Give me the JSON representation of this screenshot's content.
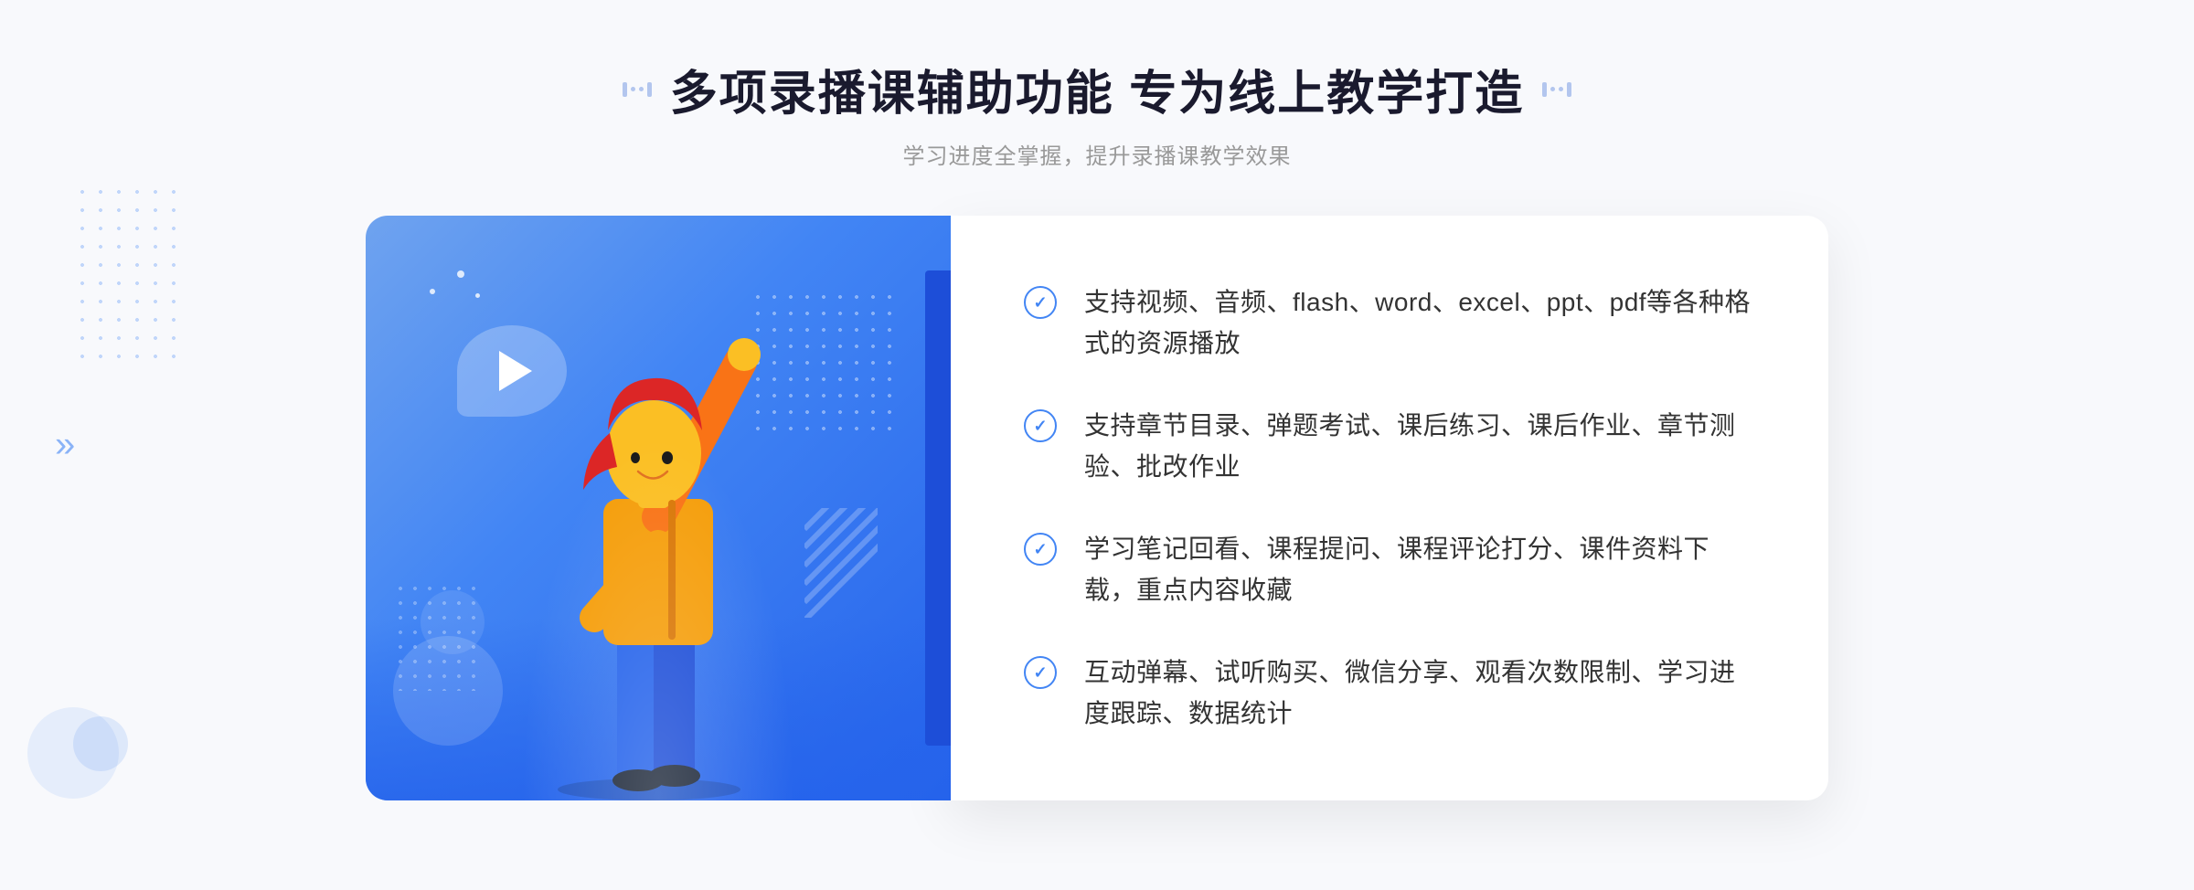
{
  "header": {
    "title": "多项录播课辅助功能 专为线上教学打造",
    "subtitle": "学习进度全掌握，提升录播课教学效果"
  },
  "features": [
    {
      "id": "feature-1",
      "text": "支持视频、音频、flash、word、excel、ppt、pdf等各种格式的资源播放"
    },
    {
      "id": "feature-2",
      "text": "支持章节目录、弹题考试、课后练习、课后作业、章节测验、批改作业"
    },
    {
      "id": "feature-3",
      "text": "学习笔记回看、课程提问、课程评论打分、课件资料下载，重点内容收藏"
    },
    {
      "id": "feature-4",
      "text": "互动弹幕、试听购买、微信分享、观看次数限制、学习进度跟踪、数据统计"
    }
  ],
  "decoration": {
    "arrow": "»",
    "check": "✓"
  }
}
